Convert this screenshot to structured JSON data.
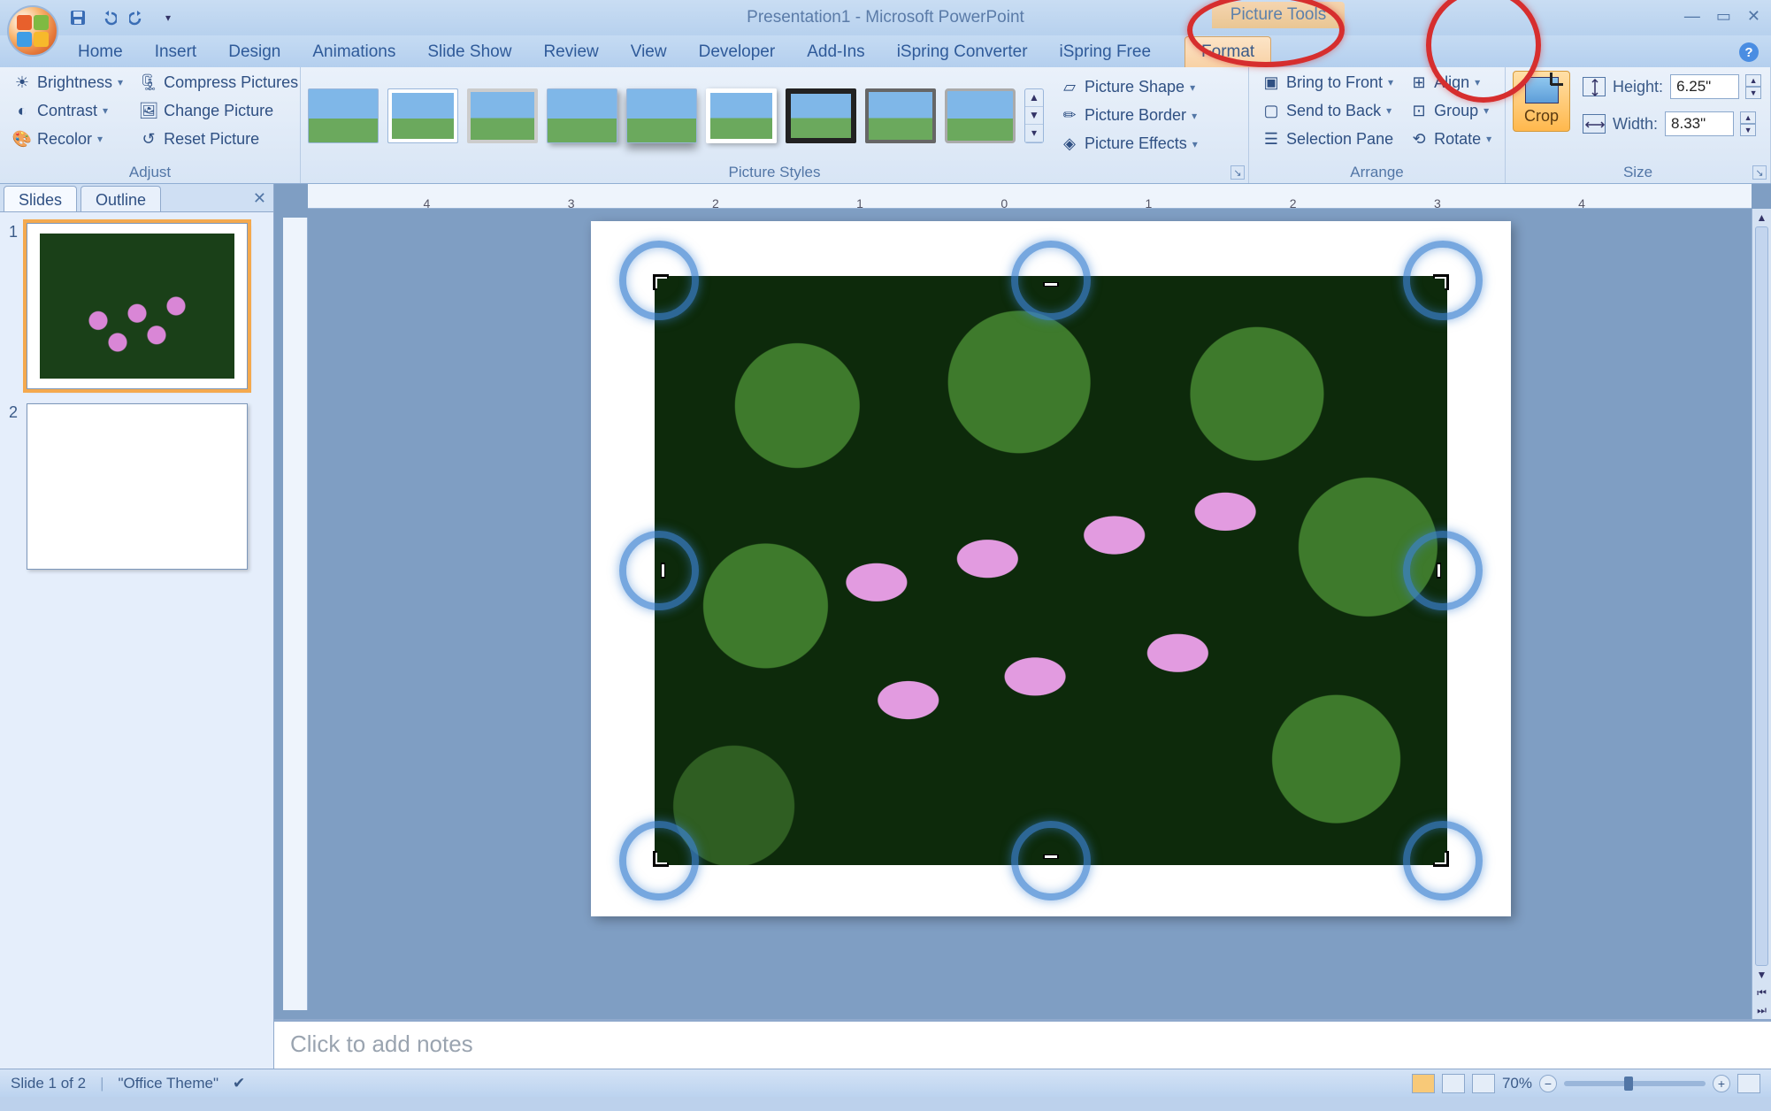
{
  "title": "Presentation1 - Microsoft PowerPoint",
  "contextual_tab": "Picture Tools",
  "tabs": [
    "Home",
    "Insert",
    "Design",
    "Animations",
    "Slide Show",
    "Review",
    "View",
    "Developer",
    "Add-Ins",
    "iSpring Converter",
    "iSpring Free",
    "Format"
  ],
  "active_tab_index": 11,
  "ribbon": {
    "adjust": {
      "label": "Adjust",
      "brightness": "Brightness",
      "contrast": "Contrast",
      "recolor": "Recolor",
      "compress": "Compress Pictures",
      "change": "Change Picture",
      "reset": "Reset Picture"
    },
    "styles": {
      "label": "Picture Styles",
      "shape": "Picture Shape",
      "border": "Picture Border",
      "effects": "Picture Effects"
    },
    "arrange": {
      "label": "Arrange",
      "front": "Bring to Front",
      "back": "Send to Back",
      "pane": "Selection Pane",
      "align": "Align",
      "group": "Group",
      "rotate": "Rotate"
    },
    "size": {
      "label": "Size",
      "crop": "Crop",
      "height_label": "Height:",
      "width_label": "Width:",
      "height_val": "6.25\"",
      "width_val": "8.33\""
    }
  },
  "slide_panel": {
    "tabs": [
      "Slides",
      "Outline"
    ],
    "active": 0,
    "slides": [
      1,
      2
    ]
  },
  "ruler_ticks": [
    "4",
    "3",
    "2",
    "1",
    "0",
    "1",
    "2",
    "3",
    "4"
  ],
  "notes_placeholder": "Click to add notes",
  "status": {
    "slide": "Slide 1 of 2",
    "theme": "\"Office Theme\"",
    "zoom": "70%"
  }
}
